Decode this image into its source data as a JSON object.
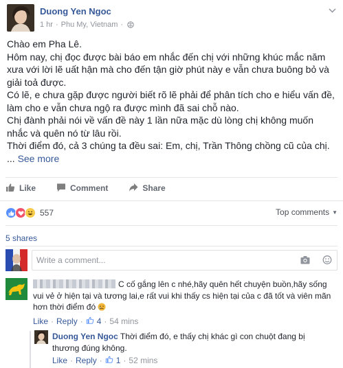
{
  "post": {
    "author": "Duong Yen Ngoc",
    "time": "1 hr",
    "location": "Phu My, Vietnam",
    "paragraphs": [
      "Chào em Pha Lê.",
      "Hôm nay, chị đọc được bài báo em nhắc đến chị với những khúc mắc năm xưa với lời lẽ uất hận mà cho đến tận giờ phút này e vẫn chưa buông bỏ và giải toả được.",
      "Có lẽ, e chưa gặp được người biết rõ lẽ phải để phân tích cho e hiểu vấn đề, làm cho e vẫn chưa ngộ ra được mình đã sai chỗ nào.",
      "Chị đành phải nói về vấn đề này 1 lần nữa mặc dù lòng chị không muốn nhắc và quên nó từ lâu rồi.",
      "Thời điểm đó, cả 3 chúng ta đều sai: Em, chị, Trần Thông chồng cũ của chị."
    ],
    "ellipsis": "...",
    "see_more": "See more"
  },
  "actions": {
    "like": "Like",
    "comment": "Comment",
    "share": "Share"
  },
  "reactions": {
    "count": "557",
    "top_comments": "Top comments"
  },
  "shares": "5 shares",
  "comment_box": {
    "placeholder": "Write a comment..."
  },
  "comments": [
    {
      "text": "C cố gắng lên c nhé,hãy quên hết chuyện buồn,hãy sống vui vẻ ở hiện tại và tương lai,e rất vui khi thấy cs hiện tại của c đã tốt và viên mãn hơn thời điểm đó",
      "like": "Like",
      "reply": "Reply",
      "like_count": "4",
      "time": "54 mins"
    },
    {
      "author": "Duong Yen Ngoc",
      "text": "Thời điểm đó, e thấy chị khác gì con chuột đang bị thương đúng không.",
      "like": "Like",
      "reply": "Reply",
      "like_count": "1",
      "time": "52 mins"
    }
  ],
  "colors": {
    "link": "#365899",
    "muted": "#90949c",
    "text": "#1d2129",
    "divider": "#e5e5e5"
  },
  "icons": [
    "globe-icon",
    "chevron-down-icon",
    "thumbs-up-icon",
    "comment-icon",
    "share-icon",
    "like-reaction-icon",
    "love-reaction-icon",
    "haha-reaction-icon",
    "camera-icon",
    "emoji-icon",
    "cry-emoji-icon"
  ]
}
